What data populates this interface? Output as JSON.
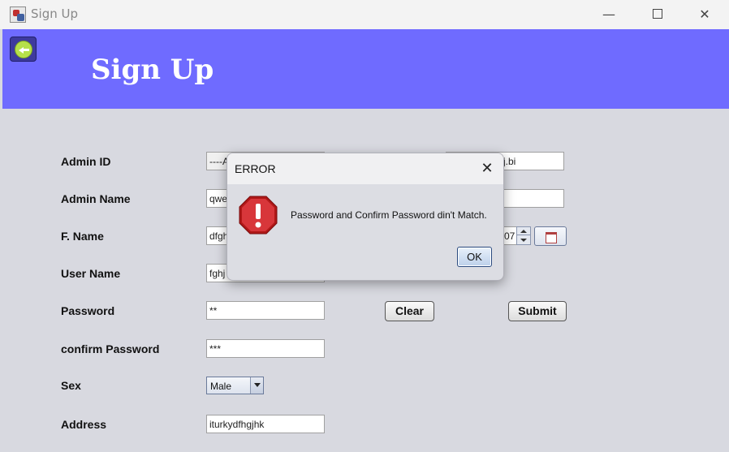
{
  "window": {
    "title": "Sign Up"
  },
  "header": {
    "title": "Sign Up",
    "color": "#6f6bff"
  },
  "form": {
    "labels": {
      "admin_id": "Admin ID",
      "admin_name": "Admin Name",
      "f_name": "F. Name",
      "user_name": "User Name",
      "password": "Password",
      "confirm_password": "confirm Password",
      "sex": "Sex",
      "address": "Address"
    },
    "values": {
      "admin_id": "----A",
      "admin_name": "qwe",
      "f_name": "dfgh",
      "user_name": "fghj",
      "password": "**",
      "confirm_password": "***",
      "sex": "Male",
      "address": "iturkydfhgjhk",
      "email_fragment": "j.bi",
      "dob_fragment": "07"
    },
    "buttons": {
      "clear": "Clear",
      "submit": "Submit"
    }
  },
  "dialog": {
    "title": "ERROR",
    "message": "Password and Confirm Password din't Match.",
    "ok": "OK"
  }
}
